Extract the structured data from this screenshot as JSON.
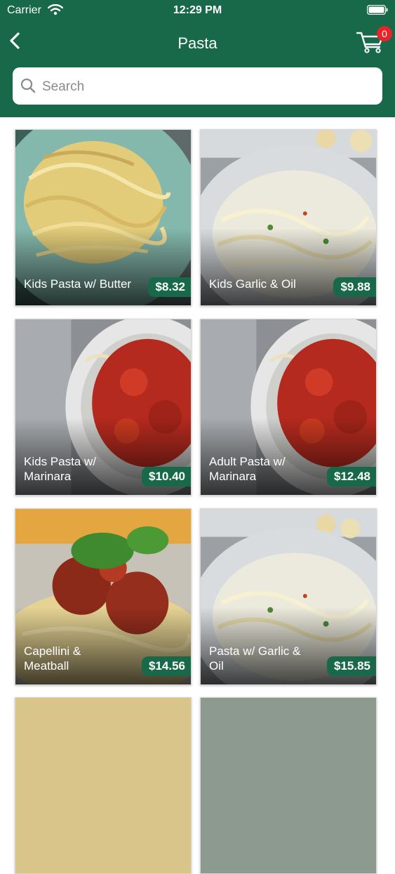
{
  "status_bar": {
    "carrier": "Carrier",
    "time": "12:29 PM"
  },
  "nav": {
    "title": "Pasta",
    "cart_count": "0"
  },
  "search": {
    "placeholder": "Search"
  },
  "items": [
    {
      "name": "Kids Pasta w/ Butter",
      "price": "$8.32"
    },
    {
      "name": "Kids Garlic & Oil",
      "price": "$9.88"
    },
    {
      "name": "Kids Pasta w/ Marinara",
      "price": "$10.40"
    },
    {
      "name": "Adult Pasta w/ Marinara",
      "price": "$12.48"
    },
    {
      "name": "Capellini & Meatball",
      "price": "$14.56"
    },
    {
      "name": "Pasta w/ Garlic & Oil",
      "price": "$15.85"
    }
  ],
  "colors": {
    "brand": "#17694a",
    "badge": "#e8232a"
  },
  "icons": {
    "back": "chevron-left-icon",
    "cart": "cart-icon",
    "search": "search-icon"
  }
}
